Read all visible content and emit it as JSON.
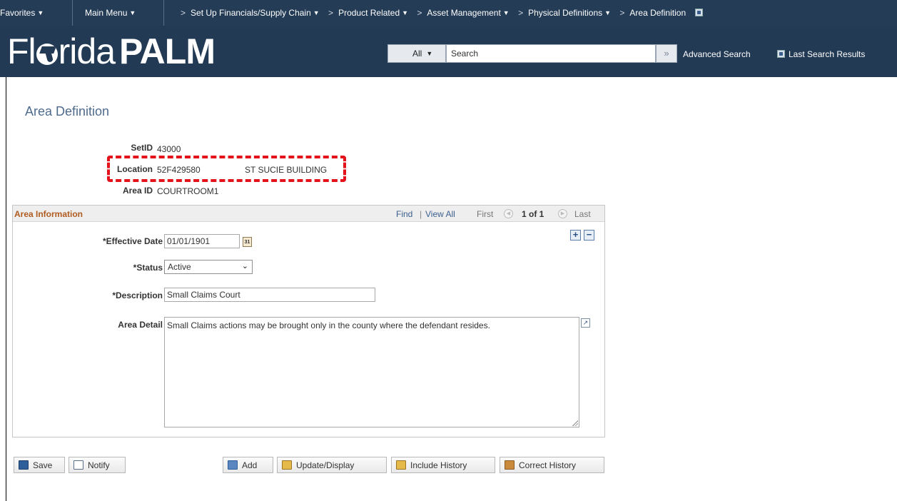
{
  "topnav": {
    "favorites": "Favorites",
    "main_menu": "Main Menu",
    "breadcrumbs": [
      "Set Up Financials/Supply Chain",
      "Product Related",
      "Asset Management",
      "Physical Definitions",
      "Area Definition"
    ]
  },
  "header": {
    "logo_light": "Fl",
    "logo_light2": "rida",
    "logo_bold": "PALM",
    "search_scope": "All",
    "search_placeholder": "Search",
    "search_go": "»",
    "advanced_search": "Advanced Search",
    "last_search_results": "Last Search Results"
  },
  "page": {
    "title": "Area Definition",
    "setid_label": "SetID",
    "setid_value": "43000",
    "location_label": "Location",
    "location_value": "52F429580",
    "location_desc": "ST SUCIE BUILDING",
    "areaid_label": "Area ID",
    "areaid_value": "COURTROOM1"
  },
  "area_info": {
    "title": "Area Information",
    "find": "Find",
    "separator": "|",
    "view_all": "View All",
    "first": "First",
    "count": "1 of 1",
    "last": "Last",
    "effective_date_label": "*Effective Date",
    "effective_date_value": "01/01/1901",
    "calendar_glyph": "31",
    "status_label": "*Status",
    "status_value": "Active",
    "description_label": "*Description",
    "description_value": "Small Claims Court",
    "area_detail_label": "Area Detail",
    "area_detail_value": "Small Claims actions may be brought only in the county where the defendant resides.",
    "add_row": "+",
    "delete_row": "−"
  },
  "toolbar": {
    "save": "Save",
    "notify": "Notify",
    "add": "Add",
    "update_display": "Update/Display",
    "include_history": "Include History",
    "correct_history": "Correct History"
  },
  "colors": {
    "nav_bg": "#243c56",
    "highlight_dash": "#e4131b",
    "group_title": "#b05c20",
    "link": "#3a5f8f"
  }
}
